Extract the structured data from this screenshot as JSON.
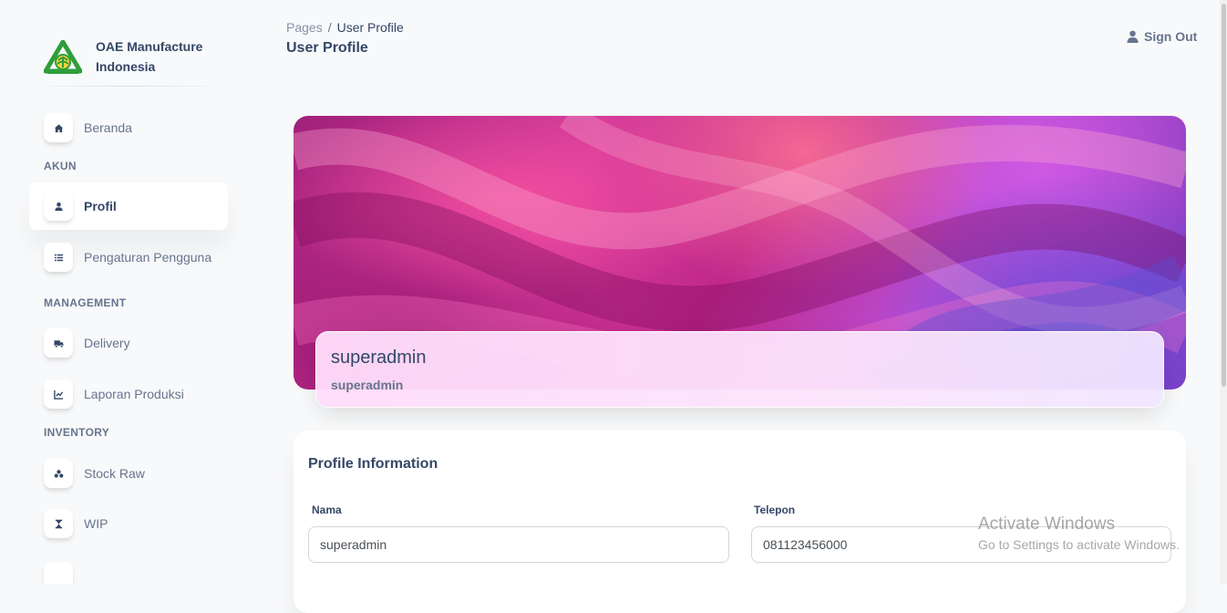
{
  "brand": {
    "name": "OAE Manufacture Indonesia"
  },
  "sidebar": {
    "items": [
      {
        "label": "Beranda",
        "icon": "home-icon"
      },
      {
        "section": "AKUN"
      },
      {
        "label": "Profil",
        "icon": "user-icon",
        "active": true
      },
      {
        "label": "Pengaturan Pengguna",
        "icon": "list-icon"
      },
      {
        "section": "MANAGEMENT"
      },
      {
        "label": "Delivery",
        "icon": "truck-icon"
      },
      {
        "label": "Laporan Produksi",
        "icon": "chart-icon"
      },
      {
        "section": "INVENTORY"
      },
      {
        "label": "Stock Raw",
        "icon": "boxes-icon"
      },
      {
        "label": "WIP",
        "icon": "hourglass-icon"
      }
    ]
  },
  "header": {
    "breadcrumb_root": "Pages",
    "breadcrumb_sep": "/",
    "breadcrumb_current": "User Profile",
    "title": "User Profile",
    "sign_out": "Sign Out"
  },
  "profile": {
    "name": "superadmin",
    "role": "superadmin"
  },
  "info": {
    "title": "Profile Information",
    "nama_label": "Nama",
    "nama_value": "superadmin",
    "telepon_label": "Telepon",
    "telepon_value": "081123456000"
  },
  "watermark": {
    "title": "Activate Windows",
    "subtitle": "Go to Settings to activate Windows."
  },
  "colors": {
    "text_primary": "#344767",
    "text_secondary": "#67748e",
    "logo_green": "#2e9e3a"
  }
}
